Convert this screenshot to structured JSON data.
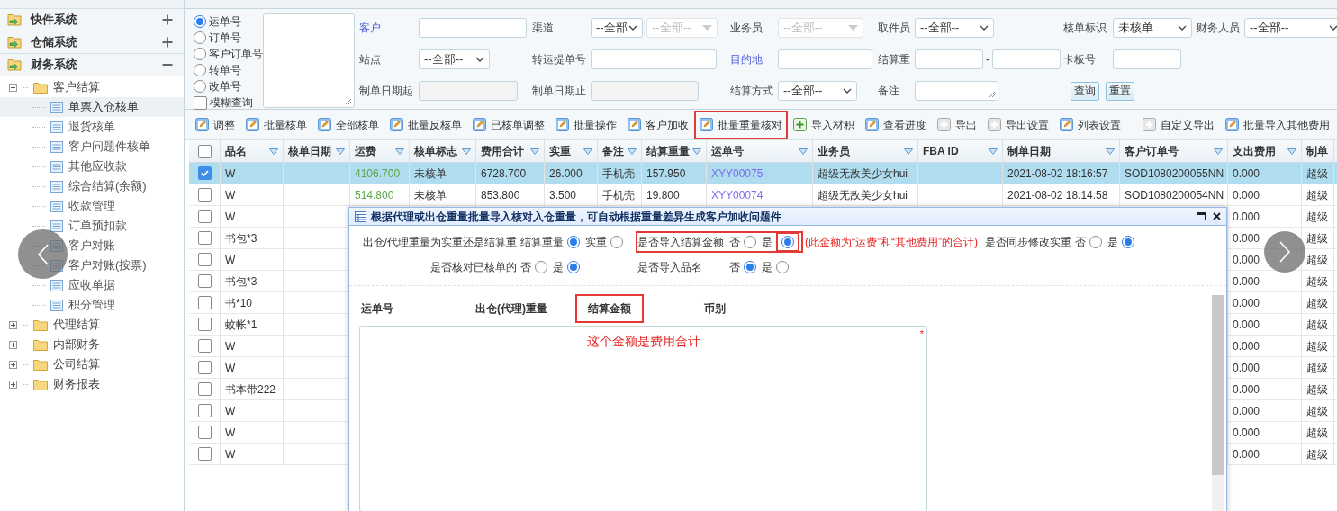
{
  "sidebar": {
    "sections": [
      {
        "label": "快件系统",
        "expanded": false
      },
      {
        "label": "仓储系统",
        "expanded": false
      },
      {
        "label": "财务系统",
        "expanded": true,
        "children": [
          {
            "label": "客户结算",
            "expanded": true,
            "children": [
              {
                "label": "单票入仓核单",
                "selected": true
              },
              {
                "label": "退货核单",
                "selected": false
              },
              {
                "label": "客户问题件核单",
                "selected": false
              },
              {
                "label": "其他应收款",
                "selected": false
              },
              {
                "label": "综合结算(余额)",
                "selected": false
              },
              {
                "label": "收款管理",
                "selected": false
              },
              {
                "label": "订单预扣款",
                "selected": false
              },
              {
                "label": "客户对账",
                "selected": false
              },
              {
                "label": "客户对账(按票)",
                "selected": false
              },
              {
                "label": "应收单据",
                "selected": false
              },
              {
                "label": "积分管理",
                "selected": false
              }
            ]
          },
          {
            "label": "代理结算",
            "expanded": false
          },
          {
            "label": "内部财务",
            "expanded": false
          },
          {
            "label": "公司结算",
            "expanded": false
          },
          {
            "label": "财务报表",
            "expanded": false
          }
        ]
      }
    ]
  },
  "search": {
    "options": [
      {
        "label": "运单号",
        "selected": true
      },
      {
        "label": "订单号",
        "selected": false
      },
      {
        "label": "客户订单号",
        "selected": false
      },
      {
        "label": "转单号",
        "selected": false
      },
      {
        "label": "改单号",
        "selected": false
      }
    ],
    "fuzzy": {
      "label": "模糊查询",
      "checked": false
    }
  },
  "filters": [
    [
      {
        "label": "客户",
        "link": true,
        "kind": "input",
        "disabled": false
      },
      {
        "label": "渠道",
        "link": false,
        "kind": "select_pair",
        "disabled": false,
        "value": "--全部",
        "value2": "--全部--"
      },
      {
        "label": "业务员",
        "link": false,
        "kind": "select",
        "disabled": true,
        "value": "--全部--"
      },
      {
        "label": "取件员",
        "link": false,
        "kind": "select",
        "disabled": false,
        "value": "--全部--"
      },
      {
        "label": "核单标识",
        "link": false,
        "kind": "select",
        "disabled": false,
        "value": "未核单"
      },
      {
        "label": "财务人员",
        "link": false,
        "kind": "select",
        "disabled": false,
        "value": "--全部--"
      }
    ],
    [
      {
        "label": "站点",
        "link": false,
        "kind": "select",
        "disabled": false,
        "value": "--全部--"
      },
      {
        "label": "转运提单号",
        "link": false,
        "kind": "input",
        "disabled": false
      },
      {
        "label": "目的地",
        "link": true,
        "kind": "input",
        "disabled": false
      },
      {
        "label": "结算重",
        "link": false,
        "kind": "range",
        "disabled": false,
        "separator": "-"
      },
      {
        "label": "卡板号",
        "link": false,
        "kind": "input",
        "disabled": false
      }
    ],
    [
      {
        "label": "制单日期起",
        "link": false,
        "kind": "input",
        "disabled": true
      },
      {
        "label": "制单日期止",
        "link": false,
        "kind": "input",
        "disabled": true
      },
      {
        "label": "结算方式",
        "link": false,
        "kind": "select",
        "disabled": false,
        "value": "--全部--"
      },
      {
        "label": "备注",
        "link": false,
        "kind": "textarea",
        "disabled": false
      },
      {
        "kind": "buttons",
        "buttons": [
          "查询",
          "重置"
        ]
      }
    ]
  ],
  "toolbar": [
    {
      "kind": "edit",
      "label": "调整",
      "highlighted": false
    },
    {
      "kind": "edit",
      "label": "批量核单",
      "highlighted": false
    },
    {
      "kind": "edit",
      "label": "全部核单",
      "highlighted": false
    },
    {
      "kind": "edit",
      "label": "批量反核单",
      "highlighted": false
    },
    {
      "kind": "edit",
      "label": "已核单调整",
      "highlighted": false
    },
    {
      "kind": "edit",
      "label": "批量操作",
      "highlighted": false
    },
    {
      "kind": "edit",
      "label": "客户加收",
      "highlighted": false
    },
    {
      "kind": "edit",
      "label": "批量重量核对",
      "highlighted": true
    },
    {
      "kind": "import",
      "label": "导入材积",
      "highlighted": false
    },
    {
      "kind": "edit",
      "label": "查看进度",
      "highlighted": false
    },
    {
      "kind": "export",
      "label": "导出",
      "highlighted": false
    },
    {
      "kind": "export",
      "label": "导出设置",
      "highlighted": false
    },
    {
      "kind": "edit",
      "label": "列表设置",
      "highlighted": false
    },
    {
      "kind": "separator"
    },
    {
      "kind": "export",
      "label": "自定义导出",
      "highlighted": false
    },
    {
      "kind": "edit",
      "label": "批量导入其他费用",
      "highlighted": false
    },
    {
      "kind": "separator"
    }
  ],
  "table": {
    "select_all_checked": false,
    "columns": [
      {
        "label": "品名",
        "kind": "text"
      },
      {
        "label": "核单日期",
        "kind": "text"
      },
      {
        "label": "运费",
        "kind": "money"
      },
      {
        "label": "核单标志",
        "kind": "text"
      },
      {
        "label": "费用合计",
        "kind": "text"
      },
      {
        "label": "实重",
        "kind": "text"
      },
      {
        "label": "备注",
        "kind": "text"
      },
      {
        "label": "结算重量",
        "kind": "text"
      },
      {
        "label": "运单号",
        "kind": "link"
      },
      {
        "label": "业务员",
        "kind": "text"
      },
      {
        "label": "FBA ID",
        "kind": "text"
      },
      {
        "label": "制单日期",
        "kind": "text"
      },
      {
        "label": "客户订单号",
        "kind": "text"
      },
      {
        "label": "支出费用",
        "kind": "text"
      },
      {
        "label": "制单",
        "kind": "text"
      }
    ],
    "rows": [
      {
        "checked": true,
        "selected": true,
        "cells": [
          "W",
          null,
          "4106.700",
          "未核单",
          "6728.700",
          "26.000",
          "手机壳",
          "157.950",
          "XYY00075",
          "超级无敌美少女hui",
          null,
          "2021-08-02 18:16:57",
          "SOD1080200055NN",
          "0.000",
          "超级"
        ]
      },
      {
        "checked": false,
        "selected": false,
        "cells": [
          "W",
          null,
          "514.800",
          "未核单",
          "853.800",
          "3.500",
          "手机壳",
          "19.800",
          "XYY00074",
          "超级无敌美少女hui",
          null,
          "2021-08-02 18:14:58",
          "SOD1080200054NN",
          "0.000",
          "超级"
        ]
      },
      {
        "checked": false,
        "selected": false,
        "cells": [
          "W",
          null,
          null,
          null,
          null,
          null,
          null,
          null,
          null,
          null,
          null,
          null,
          null,
          "0.000",
          "超级"
        ]
      },
      {
        "checked": false,
        "selected": false,
        "cells": [
          "书包*3",
          null,
          null,
          null,
          null,
          null,
          null,
          null,
          null,
          null,
          null,
          null,
          null,
          "0.000",
          "超级"
        ]
      },
      {
        "checked": false,
        "selected": false,
        "cells": [
          "W",
          null,
          null,
          null,
          null,
          null,
          null,
          null,
          null,
          null,
          null,
          null,
          null,
          "0.000",
          "超级"
        ]
      },
      {
        "checked": false,
        "selected": false,
        "cells": [
          "书包*3",
          null,
          null,
          null,
          null,
          null,
          null,
          null,
          null,
          null,
          null,
          null,
          null,
          "0.000",
          "超级"
        ]
      },
      {
        "checked": false,
        "selected": false,
        "cells": [
          "书*10",
          null,
          null,
          null,
          null,
          null,
          null,
          null,
          null,
          null,
          null,
          null,
          null,
          "0.000",
          "超级"
        ]
      },
      {
        "checked": false,
        "selected": false,
        "cells": [
          "蚊帐*1",
          null,
          null,
          null,
          null,
          null,
          null,
          null,
          null,
          null,
          null,
          null,
          null,
          "0.000",
          "超级"
        ]
      },
      {
        "checked": false,
        "selected": false,
        "cells": [
          "W",
          null,
          null,
          null,
          null,
          null,
          null,
          null,
          null,
          null,
          null,
          null,
          null,
          "0.000",
          "超级"
        ]
      },
      {
        "checked": false,
        "selected": false,
        "cells": [
          "W",
          null,
          null,
          null,
          null,
          null,
          null,
          null,
          null,
          null,
          null,
          null,
          null,
          "0.000",
          "超级"
        ]
      },
      {
        "checked": false,
        "selected": false,
        "cells": [
          "书本带222",
          null,
          null,
          null,
          null,
          null,
          null,
          null,
          null,
          null,
          null,
          null,
          null,
          "0.000",
          "超级"
        ]
      },
      {
        "checked": false,
        "selected": false,
        "cells": [
          "W",
          null,
          null,
          null,
          null,
          null,
          null,
          null,
          null,
          null,
          null,
          null,
          null,
          "0.000",
          "超级"
        ]
      },
      {
        "checked": false,
        "selected": false,
        "cells": [
          "W",
          null,
          null,
          null,
          null,
          null,
          null,
          null,
          null,
          null,
          null,
          null,
          null,
          "0.000",
          "超级"
        ]
      },
      {
        "checked": false,
        "selected": false,
        "cells": [
          "W",
          null,
          null,
          null,
          null,
          null,
          null,
          null,
          null,
          null,
          null,
          null,
          null,
          "0.000",
          "超级"
        ]
      }
    ]
  },
  "dialog": {
    "title": "根据代理或出仓重量批量导入核对入仓重量，可自动根据重量差异生成客户加收问题件",
    "option_rows": [
      [
        {
          "label": "出仓/代理重量为实重还是结算重",
          "highlighted": false,
          "choices": [
            {
              "label": "结算重量",
              "selected": true,
              "highlighted": false
            },
            {
              "label": "实重",
              "selected": false,
              "highlighted": false
            }
          ]
        },
        {
          "label": "是否导入结算金额",
          "highlighted": true,
          "choices": [
            {
              "label": "否",
              "selected": false,
              "highlighted": false
            },
            {
              "label": "是",
              "selected": true,
              "highlighted": true
            }
          ],
          "note": "(此金额为“运费”和“其他费用”的合计)"
        },
        {
          "label": "是否同步修改实重",
          "highlighted": false,
          "choices": [
            {
              "label": "否",
              "selected": false,
              "highlighted": false
            },
            {
              "label": "是",
              "selected": true,
              "highlighted": false
            }
          ]
        }
      ],
      [
        {
          "label": "是否核对已核单的",
          "highlighted": false,
          "choices": [
            {
              "label": "否",
              "selected": false,
              "highlighted": false
            },
            {
              "label": "是",
              "selected": true,
              "highlighted": false
            }
          ]
        },
        {
          "label": "是否导入品名",
          "highlighted": false,
          "choices": [
            {
              "label": "否",
              "selected": true,
              "highlighted": false
            },
            {
              "label": "是",
              "selected": false,
              "highlighted": false
            }
          ]
        }
      ]
    ],
    "columns": [
      {
        "label": "运单号",
        "highlighted": false
      },
      {
        "label": "出仓(代理)重量",
        "highlighted": false
      },
      {
        "label": "结算金额",
        "highlighted": true
      },
      {
        "label": "币别",
        "highlighted": false
      }
    ],
    "input": {
      "value": "这个金额是费用合计",
      "required_mark": "*"
    }
  }
}
